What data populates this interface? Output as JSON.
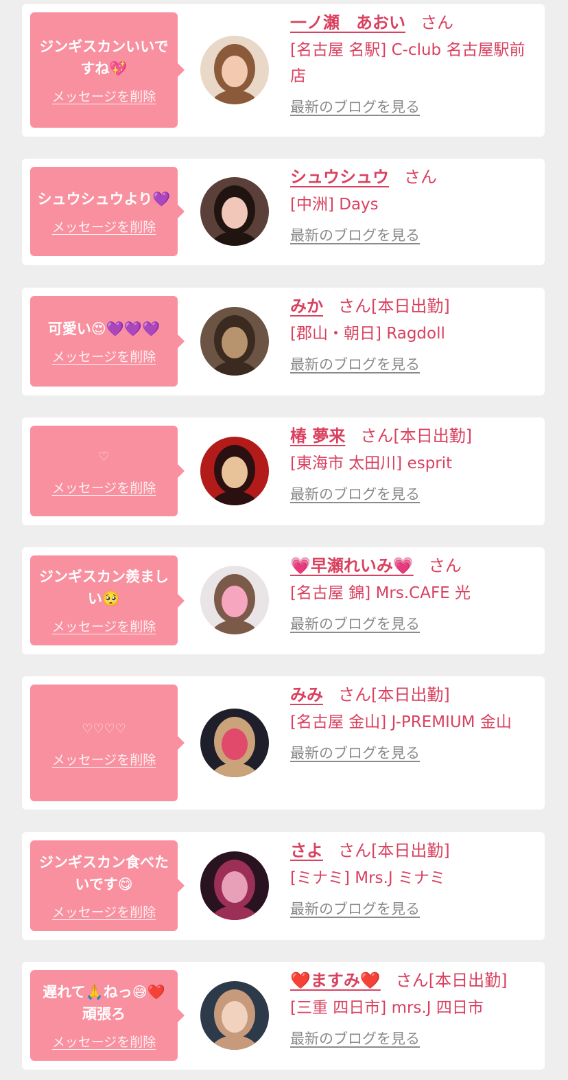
{
  "delete_label": "メッセージを削除",
  "san_label": "さん",
  "blog_label": "最新のブログを見る",
  "colors": {
    "accent": "#d9415f",
    "bubble": "#f9909f",
    "background": "#eeeeee"
  },
  "items": [
    {
      "message": "ジンギスカンいいですね💖",
      "name": "一ノ瀬　あおい",
      "today": "",
      "shop": "[名古屋 名駅] C-club 名古屋駅前店",
      "avatar_colors": [
        "#e9d8c8",
        "#8a5a3a",
        "#f3c9b0"
      ]
    },
    {
      "message": "シュウシュウより💜",
      "name": "シュウシュウ",
      "today": "",
      "shop": "[中洲] Days",
      "avatar_colors": [
        "#5a4038",
        "#1f1410",
        "#f1c7b9"
      ]
    },
    {
      "message": "可愛い😍💜💜💜",
      "name": "みか",
      "today": "[本日出勤]",
      "shop": "[郡山・朝日] Ragdoll",
      "avatar_colors": [
        "#6b5443",
        "#3a2a20",
        "#b8946e"
      ]
    },
    {
      "message": "♡",
      "name": "椿 夢来",
      "today": "[本日出勤]",
      "shop": "[東海市 太田川] esprit",
      "avatar_colors": [
        "#b31b1b",
        "#2a1010",
        "#e8c39a"
      ]
    },
    {
      "message": "ジンギスカン羨ましい🥺",
      "name": "💗早瀬れいみ💗",
      "today": "",
      "shop": "[名古屋 錦] Mrs.CAFE 光",
      "avatar_colors": [
        "#e9e4e6",
        "#7c5a4a",
        "#f7a6c0"
      ]
    },
    {
      "message": "♡♡♡♡",
      "name": "みみ",
      "today": "[本日出勤]",
      "shop": "[名古屋 金山] J-PREMIUM 金山",
      "avatar_colors": [
        "#1e1f2a",
        "#caa37a",
        "#e14a6a"
      ]
    },
    {
      "message": "ジンギスカン食べたいです😋",
      "name": "さよ",
      "today": "[本日出勤]",
      "shop": "[ミナミ] Mrs.J ミナミ",
      "avatar_colors": [
        "#2a1320",
        "#9b2f55",
        "#e8a0b8"
      ]
    },
    {
      "message": "遅れて🙏ねっ😅❤️頑張ろ",
      "name": "❤️ますみ❤️",
      "today": "[本日出勤]",
      "shop": "[三重 四日市] mrs.J 四日市",
      "avatar_colors": [
        "#2d3a4a",
        "#c79a7c",
        "#f0d2bf"
      ]
    }
  ]
}
